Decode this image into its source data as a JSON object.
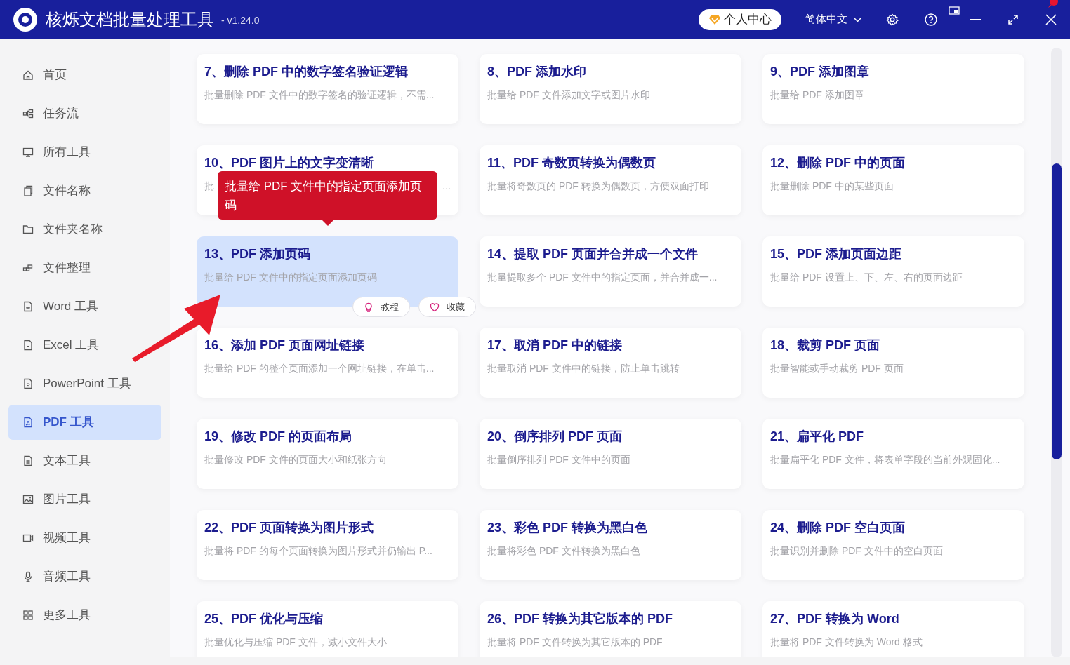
{
  "app": {
    "title": "核烁文档批量处理工具",
    "version": "- v1.24.0"
  },
  "header": {
    "account_button": "个人中心",
    "language": "简体中文"
  },
  "sidebar": {
    "items": [
      {
        "label": "首页",
        "selected": false
      },
      {
        "label": "任务流",
        "selected": false
      },
      {
        "label": "所有工具",
        "selected": false
      },
      {
        "label": "文件名称",
        "selected": false
      },
      {
        "label": "文件夹名称",
        "selected": false
      },
      {
        "label": "文件整理",
        "selected": false
      },
      {
        "label": "Word 工具",
        "selected": false
      },
      {
        "label": "Excel 工具",
        "selected": false
      },
      {
        "label": "PowerPoint 工具",
        "selected": false
      },
      {
        "label": "PDF 工具",
        "selected": true
      },
      {
        "label": "文本工具",
        "selected": false
      },
      {
        "label": "图片工具",
        "selected": false
      },
      {
        "label": "视频工具",
        "selected": false
      },
      {
        "label": "音频工具",
        "selected": false
      },
      {
        "label": "更多工具",
        "selected": false
      }
    ]
  },
  "tools": [
    {
      "title": "7、删除 PDF 中的数字签名验证逻辑",
      "description": "批量删除 PDF 文件中的数字签名的验证逻辑，不需...",
      "selected": false
    },
    {
      "title": "8、PDF 添加水印",
      "description": "批量给 PDF 文件添加文字或图片水印",
      "selected": false
    },
    {
      "title": "9、PDF 添加图章",
      "description": "批量给 PDF 添加图章",
      "selected": false
    },
    {
      "title": "10、PDF 图片上的文字变清晰",
      "description": "批",
      "description_tail": "...",
      "selected": false
    },
    {
      "title": "11、PDF 奇数页转换为偶数页",
      "description": "批量将奇数页的 PDF 转换为偶数页，方便双面打印",
      "selected": false
    },
    {
      "title": "12、删除 PDF 中的页面",
      "description": "批量删除 PDF 中的某些页面",
      "selected": false
    },
    {
      "title": "13、PDF 添加页码",
      "description": "批量给 PDF 文件中的指定页面添加页码",
      "selected": true
    },
    {
      "title": "14、提取 PDF 页面并合并成一个文件",
      "description": "批量提取多个 PDF 文件中的指定页面，并合并成一...",
      "selected": false
    },
    {
      "title": "15、PDF 添加页面边距",
      "description": "批量给 PDF 设置上、下、左、右的页面边距",
      "selected": false
    },
    {
      "title": "16、添加 PDF 页面网址链接",
      "description": "批量给 PDF 的整个页面添加一个网址链接，在单击...",
      "selected": false
    },
    {
      "title": "17、取消 PDF 中的链接",
      "description": "批量取消 PDF 文件中的链接，防止单击跳转",
      "selected": false
    },
    {
      "title": "18、裁剪 PDF 页面",
      "description": "批量智能或手动裁剪 PDF 页面",
      "selected": false
    },
    {
      "title": "19、修改 PDF 的页面布局",
      "description": "批量修改 PDF 文件的页面大小和纸张方向",
      "selected": false
    },
    {
      "title": "20、倒序排列 PDF 页面",
      "description": "批量倒序排列 PDF 文件中的页面",
      "selected": false
    },
    {
      "title": "21、扁平化 PDF",
      "description": "批量扁平化 PDF 文件，将表单字段的当前外观固化...",
      "selected": false
    },
    {
      "title": "22、PDF 页面转换为图片形式",
      "description": "批量将 PDF 的每个页面转换为图片形式并仍输出 P...",
      "selected": false
    },
    {
      "title": "23、彩色 PDF 转换为黑白色",
      "description": "批量将彩色 PDF 文件转换为黑白色",
      "selected": false
    },
    {
      "title": "24、删除 PDF 空白页面",
      "description": "批量识别并删除 PDF 文件中的空白页面",
      "selected": false
    },
    {
      "title": "25、PDF 优化与压缩",
      "description": "批量优化与压缩 PDF 文件，减小文件大小",
      "selected": false
    },
    {
      "title": "26、PDF 转换为其它版本的 PDF",
      "description": "批量将 PDF 文件转换为其它版本的 PDF",
      "selected": false
    },
    {
      "title": "27、PDF 转换为 Word",
      "description": "批量将 PDF 文件转换为 Word 格式",
      "selected": false
    }
  ],
  "tooltip": "批量给 PDF 文件中的指定页面添加页码",
  "card_actions": [
    "教程",
    "收藏"
  ]
}
